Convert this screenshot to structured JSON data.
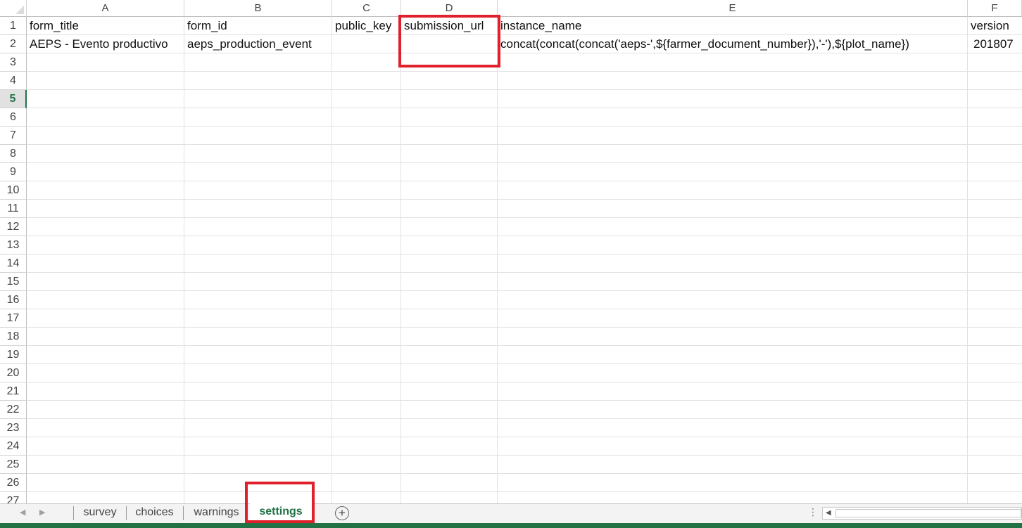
{
  "columns": [
    "A",
    "B",
    "C",
    "D",
    "E",
    "F"
  ],
  "rows": [
    "1",
    "2",
    "3",
    "4",
    "5",
    "6",
    "7",
    "8",
    "9",
    "10",
    "11",
    "12",
    "13",
    "14",
    "15",
    "16",
    "17",
    "18",
    "19",
    "20",
    "21",
    "22",
    "23",
    "24",
    "25",
    "26",
    "27"
  ],
  "active_row": "5",
  "cells": {
    "A1": "form_title",
    "B1": "form_id",
    "C1": "public_key",
    "D1": "submission_url",
    "E1": "instance_name",
    "F1": "version",
    "A2": "AEPS - Evento productivo",
    "B2": "aeps_production_event",
    "C2": "",
    "D2": "",
    "E2": "concat(concat(concat('aeps-',${farmer_document_number}),'-'),${plot_name})",
    "F2": "201807"
  },
  "sheet_tabs": [
    {
      "label": "survey",
      "active": false
    },
    {
      "label": "choices",
      "active": false
    },
    {
      "label": "warnings",
      "active": false
    },
    {
      "label": "settings",
      "active": true
    }
  ],
  "icons": {
    "nav_prev": "caret-left-icon",
    "nav_next": "caret-right-icon",
    "add_sheet": "plus-circle-icon",
    "scroll_left": "scroll-left-icon"
  },
  "colors": {
    "accent": "#217346",
    "highlight": "#e0202a",
    "gridline": "#e1e1e1"
  }
}
